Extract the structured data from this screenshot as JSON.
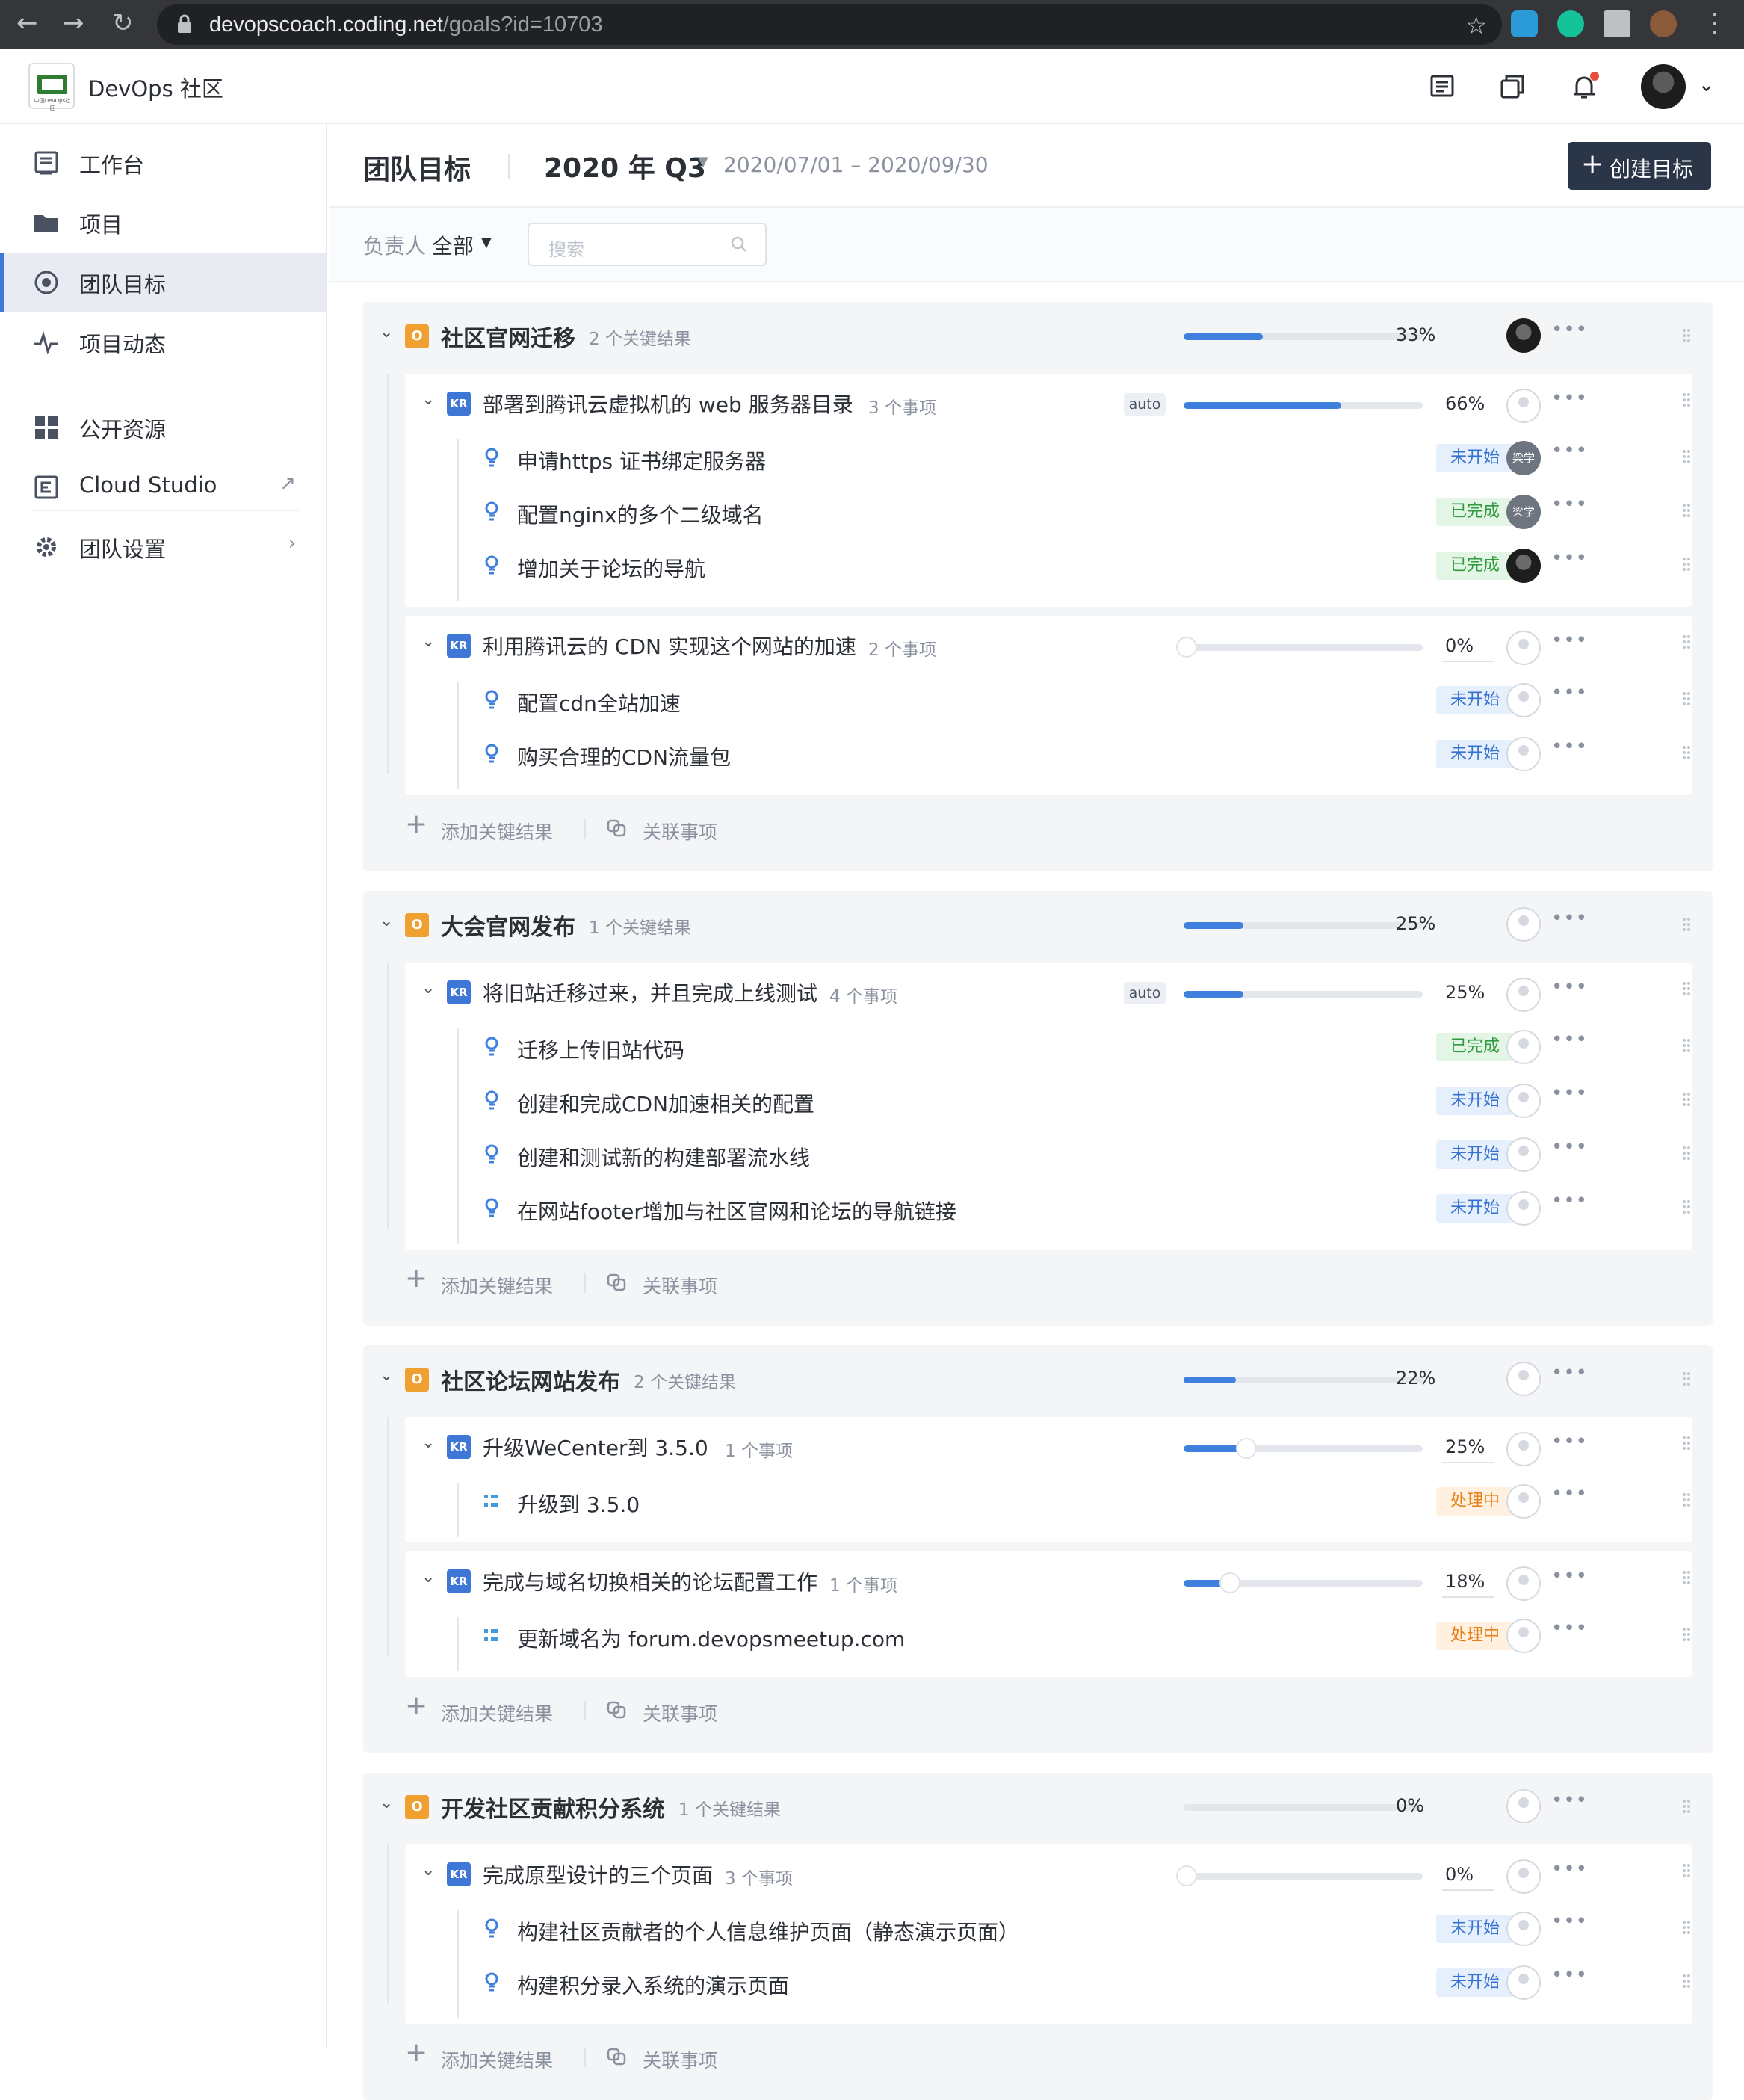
{
  "browser": {
    "url_host": "devopscoach.coding.net",
    "url_path": "/goals?id=10703"
  },
  "app": {
    "brand": "DevOps 社区",
    "logo_caption": "中国DevOps社区"
  },
  "sidebar": {
    "items": [
      {
        "label": "工作台",
        "icon": "workbench-icon"
      },
      {
        "label": "项目",
        "icon": "folder-icon"
      },
      {
        "label": "团队目标",
        "icon": "target-icon",
        "active": true
      },
      {
        "label": "项目动态",
        "icon": "activity-icon"
      },
      {
        "label": "公开资源",
        "icon": "grid-icon"
      },
      {
        "label": "Cloud Studio",
        "icon": "cloud-studio-icon",
        "right": "↗"
      },
      {
        "label": "团队设置",
        "icon": "gear-icon",
        "right": "›"
      }
    ]
  },
  "header": {
    "title": "团队目标",
    "period": "2020 年 Q3",
    "date_range": "2020/07/01 – 2020/09/30",
    "create_label": "创建目标"
  },
  "filter": {
    "owner_label": "负责人",
    "owner_value": "全部",
    "search_placeholder": "搜索"
  },
  "actions": {
    "add_kr": "添加关键结果",
    "link_items": "关联事项"
  },
  "objectives": [
    {
      "badge": "O",
      "title": "社区官网迁移",
      "count": "2 个关键结果",
      "pct": "33%",
      "progress": 0.33,
      "krs": [
        {
          "badge": "KR",
          "title": "部署到腾讯云虚拟机的 web 服务器目录",
          "count": "3 个事项",
          "auto": "auto",
          "pct": "66%",
          "progress": 0.66,
          "items": [
            {
              "title": "申请https 证书绑定服务器",
              "status": "未开始",
              "assignee": "梁学"
            },
            {
              "title": "配置nginx的多个二级域名",
              "status": "已完成",
              "assignee": "梁学"
            },
            {
              "title": "增加关于论坛的导航",
              "status": "已完成",
              "assignee": ""
            }
          ]
        },
        {
          "badge": "KR",
          "title": "利用腾讯云的 CDN 实现这个网站的加速",
          "count": "2 个事项",
          "pct": "0%",
          "progress": 0,
          "items": [
            {
              "title": "配置cdn全站加速",
              "status": "未开始"
            },
            {
              "title": "购买合理的CDN流量包",
              "status": "未开始"
            }
          ]
        }
      ]
    },
    {
      "badge": "O",
      "title": "大会官网发布",
      "count": "1 个关键结果",
      "pct": "25%",
      "progress": 0.25,
      "krs": [
        {
          "badge": "KR",
          "title": "将旧站迁移过来，并且完成上线测试",
          "count": "4 个事项",
          "auto": "auto",
          "pct": "25%",
          "progress": 0.25,
          "items": [
            {
              "title": "迁移上传旧站代码",
              "status": "已完成"
            },
            {
              "title": "创建和完成CDN加速相关的配置",
              "status": "未开始"
            },
            {
              "title": "创建和测试新的构建部署流水线",
              "status": "未开始"
            },
            {
              "title": "在网站footer增加与社区官网和论坛的导航链接",
              "status": "未开始"
            }
          ]
        }
      ]
    },
    {
      "badge": "O",
      "title": "社区论坛网站发布",
      "count": "2 个关键结果",
      "pct": "22%",
      "progress": 0.22,
      "krs": [
        {
          "badge": "KR",
          "title": "升级WeCenter到 3.5.0",
          "count": "1 个事项",
          "pct": "25%",
          "progress": 0.25,
          "items": [
            {
              "title": "升级到 3.5.0",
              "status": "处理中"
            }
          ]
        },
        {
          "badge": "KR",
          "title": "完成与域名切换相关的论坛配置工作",
          "count": "1 个事项",
          "pct": "18%",
          "progress": 0.18,
          "items": [
            {
              "title": "更新域名为 forum.devopsmeetup.com",
              "status": "处理中"
            }
          ]
        }
      ]
    },
    {
      "badge": "O",
      "title": "开发社区贡献积分系统",
      "count": "1 个关键结果",
      "pct": "0%",
      "progress": 0,
      "krs": [
        {
          "badge": "KR",
          "title": "完成原型设计的三个页面",
          "count": "3 个事项",
          "pct": "0%",
          "progress": 0,
          "items": [
            {
              "title": "构建社区贡献者的个人信息维护页面（静态演示页面）",
              "status": "未开始"
            },
            {
              "title": "构建积分录入系统的演示页面",
              "status": "未开始"
            }
          ]
        }
      ]
    }
  ],
  "more_glyph": "•••",
  "colors": {
    "accent": "#3f77d6",
    "objective": "#f0a030",
    "todo": "#3571d1",
    "done": "#2f9a3e",
    "doing": "#e5801a"
  }
}
